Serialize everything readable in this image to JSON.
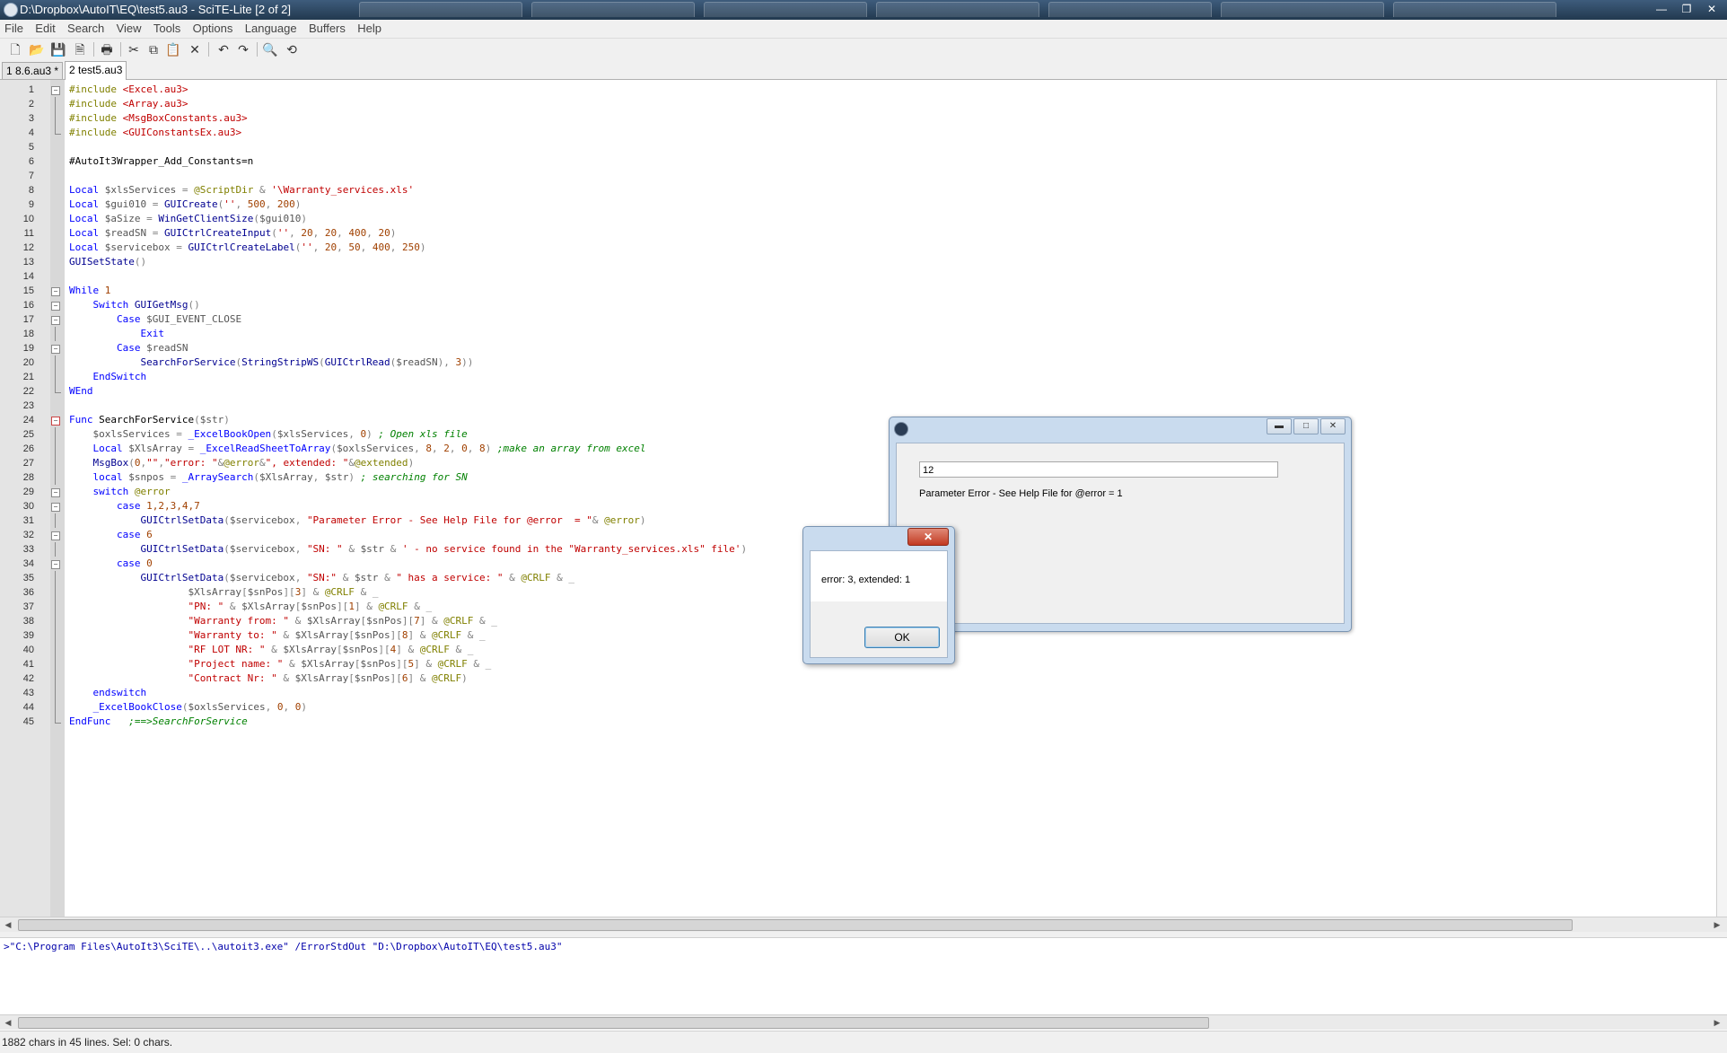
{
  "window": {
    "title": "D:\\Dropbox\\AutoIT\\EQ\\test5.au3 - SciTE-Lite [2 of 2]",
    "controls": [
      "—",
      "❐",
      "✕"
    ]
  },
  "menu": [
    "File",
    "Edit",
    "Search",
    "View",
    "Tools",
    "Options",
    "Language",
    "Buffers",
    "Help"
  ],
  "toolbar": {
    "icons": [
      "new-file-icon",
      "open-folder-icon",
      "save-icon",
      "close-file-icon",
      "print-icon",
      "cut-icon",
      "copy-icon",
      "paste-icon",
      "delete-icon",
      "undo-icon",
      "redo-icon",
      "find-icon",
      "replace-icon"
    ]
  },
  "file_tabs": [
    {
      "label": "1 8.6.au3 *",
      "active": false
    },
    {
      "label": "2 test5.au3",
      "active": true
    }
  ],
  "code_lines": [
    {
      "n": "1",
      "fold": "open",
      "html": "<span class=\"c-dir\">#include</span> <span class=\"c-str\">&lt;Excel.au3&gt;</span>"
    },
    {
      "n": "2",
      "fold": "bar",
      "html": "<span class=\"c-dir\">#include</span> <span class=\"c-str\">&lt;Array.au3&gt;</span>"
    },
    {
      "n": "3",
      "fold": "bar",
      "html": "<span class=\"c-dir\">#include</span> <span class=\"c-str\">&lt;MsgBoxConstants.au3&gt;</span>"
    },
    {
      "n": "4",
      "fold": "end",
      "html": "<span class=\"c-dir\">#include</span> <span class=\"c-str\">&lt;GUIConstantsEx.au3&gt;</span>"
    },
    {
      "n": "5",
      "fold": "",
      "html": ""
    },
    {
      "n": "6",
      "fold": "",
      "html": "#AutoIt3Wrapper_Add_Constants=n"
    },
    {
      "n": "7",
      "fold": "",
      "html": ""
    },
    {
      "n": "8",
      "fold": "",
      "html": "<span class=\"c-kw\">Local</span> <span class=\"c-var\">$xlsServices</span> <span class=\"c-op\">=</span> <span class=\"c-mac\">@ScriptDir</span> <span class=\"c-op\">&amp;</span> <span class=\"c-str\">'\\Warranty_services.xls'</span>"
    },
    {
      "n": "9",
      "fold": "",
      "html": "<span class=\"c-kw\">Local</span> <span class=\"c-var\">$gui010</span> <span class=\"c-op\">=</span> <span class=\"c-func\">GUICreate</span><span class=\"c-op\">(</span><span class=\"c-str\">''</span><span class=\"c-op\">,</span> <span class=\"c-num\">500</span><span class=\"c-op\">,</span> <span class=\"c-num\">200</span><span class=\"c-op\">)</span>"
    },
    {
      "n": "10",
      "fold": "",
      "html": "<span class=\"c-kw\">Local</span> <span class=\"c-var\">$aSize</span> <span class=\"c-op\">=</span> <span class=\"c-func\">WinGetClientSize</span><span class=\"c-op\">(</span><span class=\"c-var\">$gui010</span><span class=\"c-op\">)</span>"
    },
    {
      "n": "11",
      "fold": "",
      "html": "<span class=\"c-kw\">Local</span> <span class=\"c-var\">$readSN</span> <span class=\"c-op\">=</span> <span class=\"c-func\">GUICtrlCreateInput</span><span class=\"c-op\">(</span><span class=\"c-str\">''</span><span class=\"c-op\">,</span> <span class=\"c-num\">20</span><span class=\"c-op\">,</span> <span class=\"c-num\">20</span><span class=\"c-op\">,</span> <span class=\"c-num\">400</span><span class=\"c-op\">,</span> <span class=\"c-num\">20</span><span class=\"c-op\">)</span>"
    },
    {
      "n": "12",
      "fold": "",
      "html": "<span class=\"c-kw\">Local</span> <span class=\"c-var\">$servicebox</span> <span class=\"c-op\">=</span> <span class=\"c-func\">GUICtrlCreateLabel</span><span class=\"c-op\">(</span><span class=\"c-str\">''</span><span class=\"c-op\">,</span> <span class=\"c-num\">20</span><span class=\"c-op\">,</span> <span class=\"c-num\">50</span><span class=\"c-op\">,</span> <span class=\"c-num\">400</span><span class=\"c-op\">,</span> <span class=\"c-num\">250</span><span class=\"c-op\">)</span>"
    },
    {
      "n": "13",
      "fold": "",
      "html": "<span class=\"c-func\">GUISetState</span><span class=\"c-op\">()</span>"
    },
    {
      "n": "14",
      "fold": "",
      "html": ""
    },
    {
      "n": "15",
      "fold": "open",
      "html": "<span class=\"c-kw\">While</span> <span class=\"c-num\">1</span>"
    },
    {
      "n": "16",
      "fold": "open",
      "html": "    <span class=\"c-kw\">Switch</span> <span class=\"c-func\">GUIGetMsg</span><span class=\"c-op\">()</span>"
    },
    {
      "n": "17",
      "fold": "open",
      "html": "        <span class=\"c-kw\">Case</span> <span class=\"c-var\">$GUI_EVENT_CLOSE</span>"
    },
    {
      "n": "18",
      "fold": "bar",
      "html": "            <span class=\"c-kw\">Exit</span>"
    },
    {
      "n": "19",
      "fold": "open",
      "html": "        <span class=\"c-kw\">Case</span> <span class=\"c-var\">$readSN</span>"
    },
    {
      "n": "20",
      "fold": "bar",
      "html": "            <span class=\"c-func\">SearchForService</span><span class=\"c-op\">(</span><span class=\"c-func\">StringStripWS</span><span class=\"c-op\">(</span><span class=\"c-func\">GUICtrlRead</span><span class=\"c-op\">(</span><span class=\"c-var\">$readSN</span><span class=\"c-op\">),</span> <span class=\"c-num\">3</span><span class=\"c-op\">))</span>"
    },
    {
      "n": "21",
      "fold": "bar",
      "html": "    <span class=\"c-kw\">EndSwitch</span>"
    },
    {
      "n": "22",
      "fold": "end",
      "html": "<span class=\"c-kw\">WEnd</span>"
    },
    {
      "n": "23",
      "fold": "",
      "html": ""
    },
    {
      "n": "24",
      "fold": "open-red",
      "html": "<span class=\"c-kw\">Func</span> SearchForService<span class=\"c-op\">(</span><span class=\"c-var\">$str</span><span class=\"c-op\">)</span>"
    },
    {
      "n": "25",
      "fold": "bar",
      "html": "    <span class=\"c-var\">$oxlsServices</span> <span class=\"c-op\">=</span> <span class=\"c-kw\">_ExcelBookOpen</span><span class=\"c-op\">(</span><span class=\"c-var\">$xlsServices</span><span class=\"c-op\">,</span> <span class=\"c-num\">0</span><span class=\"c-op\">)</span> <span class=\"c-com\">; Open xls file</span>"
    },
    {
      "n": "26",
      "fold": "bar",
      "html": "    <span class=\"c-kw\">Local</span> <span class=\"c-var\">$XlsArray</span> <span class=\"c-op\">=</span> <span class=\"c-kw\">_ExcelReadSheetToArray</span><span class=\"c-op\">(</span><span class=\"c-var\">$oxlsServices</span><span class=\"c-op\">,</span> <span class=\"c-num\">8</span><span class=\"c-op\">,</span> <span class=\"c-num\">2</span><span class=\"c-op\">,</span> <span class=\"c-num\">0</span><span class=\"c-op\">,</span> <span class=\"c-num\">8</span><span class=\"c-op\">)</span> <span class=\"c-com\">;make an array from excel</span>"
    },
    {
      "n": "27",
      "fold": "bar",
      "html": "    <span class=\"c-func\">MsgBox</span><span class=\"c-op\">(</span><span class=\"c-num\">0</span><span class=\"c-op\">,</span><span class=\"c-str\">\"\"</span><span class=\"c-op\">,</span><span class=\"c-str\">\"error: \"</span><span class=\"c-op\">&amp;</span><span class=\"c-mac\">@error</span><span class=\"c-op\">&amp;</span><span class=\"c-str\">\", extended: \"</span><span class=\"c-op\">&amp;</span><span class=\"c-mac\">@extended</span><span class=\"c-op\">)</span>"
    },
    {
      "n": "28",
      "fold": "bar",
      "html": "    <span class=\"c-kw\">local</span> <span class=\"c-var\">$snpos</span> <span class=\"c-op\">=</span> <span class=\"c-kw\">_ArraySearch</span><span class=\"c-op\">(</span><span class=\"c-var\">$XlsArray</span><span class=\"c-op\">,</span> <span class=\"c-var\">$str</span><span class=\"c-op\">)</span> <span class=\"c-com\">; searching for SN</span>"
    },
    {
      "n": "29",
      "fold": "open",
      "html": "    <span class=\"c-kw\">switch</span> <span class=\"c-mac\">@error</span>"
    },
    {
      "n": "30",
      "fold": "open",
      "html": "        <span class=\"c-kw\">case</span> <span class=\"c-num\">1,2,3,4,7</span>"
    },
    {
      "n": "31",
      "fold": "bar",
      "html": "            <span class=\"c-func\">GUICtrlSetData</span><span class=\"c-op\">(</span><span class=\"c-var\">$servicebox</span><span class=\"c-op\">,</span> <span class=\"c-str\">\"Parameter Error - See Help File for @error  = \"</span><span class=\"c-op\">&amp;</span> <span class=\"c-mac\">@error</span><span class=\"c-op\">)</span>"
    },
    {
      "n": "32",
      "fold": "open",
      "html": "        <span class=\"c-kw\">case</span> <span class=\"c-num\">6</span>"
    },
    {
      "n": "33",
      "fold": "bar",
      "html": "            <span class=\"c-func\">GUICtrlSetData</span><span class=\"c-op\">(</span><span class=\"c-var\">$servicebox</span><span class=\"c-op\">,</span> <span class=\"c-str\">\"SN: \"</span> <span class=\"c-op\">&amp;</span> <span class=\"c-var\">$str</span> <span class=\"c-op\">&amp;</span> <span class=\"c-str\">' - no service found in the \"Warranty_services.xls\" file'</span><span class=\"c-op\">)</span>"
    },
    {
      "n": "34",
      "fold": "open",
      "html": "        <span class=\"c-kw\">case</span> <span class=\"c-num\">0</span>"
    },
    {
      "n": "35",
      "fold": "bar",
      "html": "            <span class=\"c-func\">GUICtrlSetData</span><span class=\"c-op\">(</span><span class=\"c-var\">$servicebox</span><span class=\"c-op\">,</span> <span class=\"c-str\">\"SN:\"</span> <span class=\"c-op\">&amp;</span> <span class=\"c-var\">$str</span> <span class=\"c-op\">&amp;</span> <span class=\"c-str\">\" has a service: \"</span> <span class=\"c-op\">&amp;</span> <span class=\"c-mac\">@CRLF</span> <span class=\"c-op\">&amp;</span> <span class=\"c-op\">_</span>"
    },
    {
      "n": "36",
      "fold": "bar",
      "html": "                    <span class=\"c-var\">$XlsArray</span><span class=\"c-op\">[</span><span class=\"c-var\">$snPos</span><span class=\"c-op\">][</span><span class=\"c-num\">3</span><span class=\"c-op\">]</span> <span class=\"c-op\">&amp;</span> <span class=\"c-mac\">@CRLF</span> <span class=\"c-op\">&amp;</span> <span class=\"c-op\">_</span>"
    },
    {
      "n": "37",
      "fold": "bar",
      "html": "                    <span class=\"c-str\">\"PN: \"</span> <span class=\"c-op\">&amp;</span> <span class=\"c-var\">$XlsArray</span><span class=\"c-op\">[</span><span class=\"c-var\">$snPos</span><span class=\"c-op\">][</span><span class=\"c-num\">1</span><span class=\"c-op\">]</span> <span class=\"c-op\">&amp;</span> <span class=\"c-mac\">@CRLF</span> <span class=\"c-op\">&amp;</span> <span class=\"c-op\">_</span>"
    },
    {
      "n": "38",
      "fold": "bar",
      "html": "                    <span class=\"c-str\">\"Warranty from: \"</span> <span class=\"c-op\">&amp;</span> <span class=\"c-var\">$XlsArray</span><span class=\"c-op\">[</span><span class=\"c-var\">$snPos</span><span class=\"c-op\">][</span><span class=\"c-num\">7</span><span class=\"c-op\">]</span> <span class=\"c-op\">&amp;</span> <span class=\"c-mac\">@CRLF</span> <span class=\"c-op\">&amp;</span> <span class=\"c-op\">_</span>"
    },
    {
      "n": "39",
      "fold": "bar",
      "html": "                    <span class=\"c-str\">\"Warranty to: \"</span> <span class=\"c-op\">&amp;</span> <span class=\"c-var\">$XlsArray</span><span class=\"c-op\">[</span><span class=\"c-var\">$snPos</span><span class=\"c-op\">][</span><span class=\"c-num\">8</span><span class=\"c-op\">]</span> <span class=\"c-op\">&amp;</span> <span class=\"c-mac\">@CRLF</span> <span class=\"c-op\">&amp;</span> <span class=\"c-op\">_</span>"
    },
    {
      "n": "40",
      "fold": "bar",
      "html": "                    <span class=\"c-str\">\"RF LOT NR: \"</span> <span class=\"c-op\">&amp;</span> <span class=\"c-var\">$XlsArray</span><span class=\"c-op\">[</span><span class=\"c-var\">$snPos</span><span class=\"c-op\">][</span><span class=\"c-num\">4</span><span class=\"c-op\">]</span> <span class=\"c-op\">&amp;</span> <span class=\"c-mac\">@CRLF</span> <span class=\"c-op\">&amp;</span> <span class=\"c-op\">_</span>"
    },
    {
      "n": "41",
      "fold": "bar",
      "html": "                    <span class=\"c-str\">\"Project name: \"</span> <span class=\"c-op\">&amp;</span> <span class=\"c-var\">$XlsArray</span><span class=\"c-op\">[</span><span class=\"c-var\">$snPos</span><span class=\"c-op\">][</span><span class=\"c-num\">5</span><span class=\"c-op\">]</span> <span class=\"c-op\">&amp;</span> <span class=\"c-mac\">@CRLF</span> <span class=\"c-op\">&amp;</span> <span class=\"c-op\">_</span>"
    },
    {
      "n": "42",
      "fold": "bar",
      "html": "                    <span class=\"c-str\">\"Contract Nr: \"</span> <span class=\"c-op\">&amp;</span> <span class=\"c-var\">$XlsArray</span><span class=\"c-op\">[</span><span class=\"c-var\">$snPos</span><span class=\"c-op\">][</span><span class=\"c-num\">6</span><span class=\"c-op\">]</span> <span class=\"c-op\">&amp;</span> <span class=\"c-mac\">@CRLF</span><span class=\"c-op\">)</span>"
    },
    {
      "n": "43",
      "fold": "bar",
      "html": "    <span class=\"c-kw\">endswitch</span>"
    },
    {
      "n": "44",
      "fold": "bar",
      "html": "    <span class=\"c-kw\">_ExcelBookClose</span><span class=\"c-op\">(</span><span class=\"c-var\">$oxlsServices</span><span class=\"c-op\">,</span> <span class=\"c-num\">0</span><span class=\"c-op\">,</span> <span class=\"c-num\">0</span><span class=\"c-op\">)</span>"
    },
    {
      "n": "45",
      "fold": "end",
      "html": "<span class=\"c-kw\">EndFunc</span>   <span class=\"c-com\">;==&gt;SearchForService</span>"
    }
  ],
  "output_pane": {
    "line": ">\"C:\\Program Files\\AutoIt3\\SciTE\\..\\autoit3.exe\" /ErrorStdOut \"D:\\Dropbox\\AutoIT\\EQ\\test5.au3\""
  },
  "status_bar": {
    "text": "1882 chars in 45 lines. Sel: 0 chars."
  },
  "gui_window": {
    "input_value": "12",
    "label_text": "Parameter Error - See Help File for @error  = 1",
    "controls": [
      "▬",
      "□",
      "✕"
    ]
  },
  "msgbox": {
    "message": "error: 3, extended: 1",
    "ok_label": "OK",
    "close_label": "✕"
  },
  "colors": {
    "keyword": "#0000ff",
    "string": "#c00000",
    "comment": "#008000",
    "directive": "#808000"
  }
}
